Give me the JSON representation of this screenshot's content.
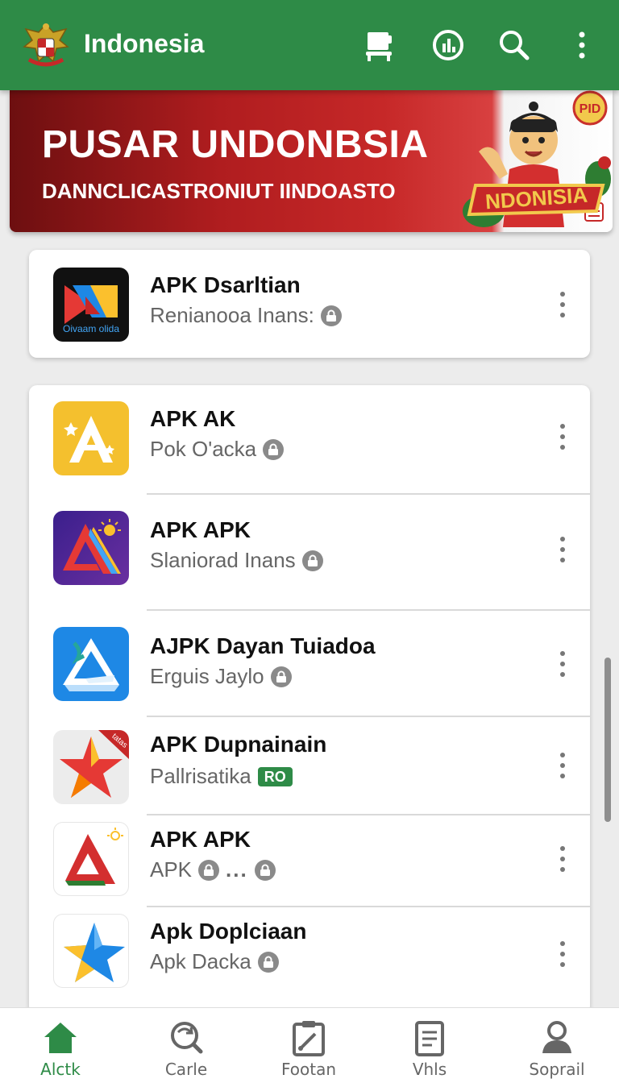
{
  "app_bar": {
    "title": "Indonesia",
    "actions": [
      "store-icon",
      "chart-icon",
      "search-icon",
      "overflow-menu-icon"
    ],
    "color": "#2e8b47"
  },
  "banner": {
    "title": "PUSAR UNDONBSIA",
    "subtitle": "DANNCLICASTRONIUT IINDOASTO",
    "ribbon": "NDONISIA",
    "sticker": "PID"
  },
  "featured_app": {
    "name": "APK Dsarltian",
    "subtitle": "Renianooa Inans:",
    "icon_text": "Oivaam olida",
    "icon": "play-logo-icon"
  },
  "app_list": [
    {
      "name": "APK AK",
      "subtitle": "Pok O'acka",
      "icon": "letter-a-yellow-icon",
      "badge": "lock"
    },
    {
      "name": "APK APK",
      "subtitle": "Slaniorad Inans",
      "icon": "triangle-purple-icon",
      "badge": "lock"
    },
    {
      "name": "AJPK Dayan Tuiadoa",
      "subtitle": "Erguis Jaylo",
      "icon": "delta-blue-icon",
      "badge": "lock"
    },
    {
      "name": "APK Dupnainain",
      "subtitle": "Pallrisatika",
      "icon": "star-red-icon",
      "badge": "text",
      "badge_text": "RO",
      "corner_text": "tatas"
    },
    {
      "name": "APK APK",
      "subtitle": "APK",
      "subtitle_extra": "...",
      "icon": "letter-a-red-icon",
      "badge": "lock-double"
    },
    {
      "name": "Apk Doplciaan",
      "subtitle": "Apk Dacka",
      "icon": "star-blue-icon",
      "badge": "lock"
    }
  ],
  "bottom_nav": [
    {
      "label": "Alctk",
      "icon": "home-icon",
      "active": true
    },
    {
      "label": "Carle",
      "icon": "refresh-search-icon",
      "active": false
    },
    {
      "label": "Footan",
      "icon": "clipboard-icon",
      "active": false
    },
    {
      "label": "Vhls",
      "icon": "document-icon",
      "active": false
    },
    {
      "label": "Soprail",
      "icon": "profile-icon",
      "active": false
    }
  ]
}
